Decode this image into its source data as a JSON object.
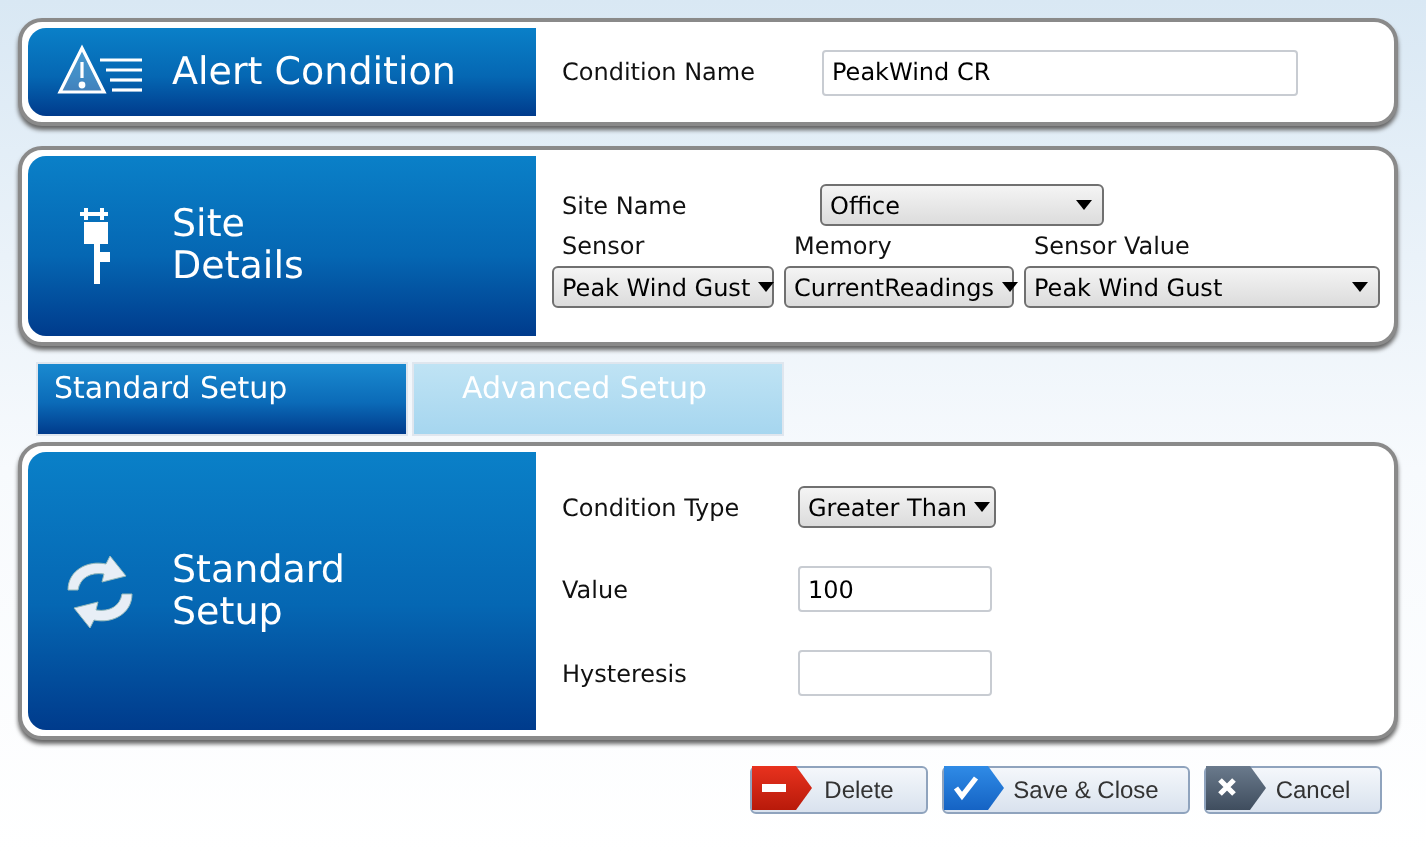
{
  "alert_condition": {
    "title": [
      "Alert Condition"
    ],
    "condition_name_label": "Condition Name",
    "condition_name": "PeakWind CR"
  },
  "site_details": {
    "title": [
      "Site",
      "Details"
    ],
    "site_name_label": "Site Name",
    "site_name": "Office",
    "selectors": [
      {
        "label": "Sensor",
        "value": "Peak Wind Gust"
      },
      {
        "label": "Memory",
        "value": "CurrentReadings"
      },
      {
        "label": "Sensor Value",
        "value": "Peak Wind Gust"
      }
    ]
  },
  "tabs": [
    {
      "label": "Standard Setup",
      "selected": true
    },
    {
      "label": "Advanced Setup",
      "selected": false
    }
  ],
  "standard_setup": {
    "title": [
      "Standard",
      "Setup"
    ],
    "fields": [
      {
        "kind": "dropdown",
        "label": "Condition Type",
        "value": "Greater Than"
      },
      {
        "kind": "input",
        "label": "Value",
        "value": "100"
      },
      {
        "kind": "input",
        "label": "Hysteresis"
      }
    ]
  },
  "buttons": [
    {
      "kind": "delete",
      "label": "Delete"
    },
    {
      "kind": "save",
      "label": "Save & Close"
    },
    {
      "kind": "cancel",
      "label": "Cancel"
    }
  ]
}
